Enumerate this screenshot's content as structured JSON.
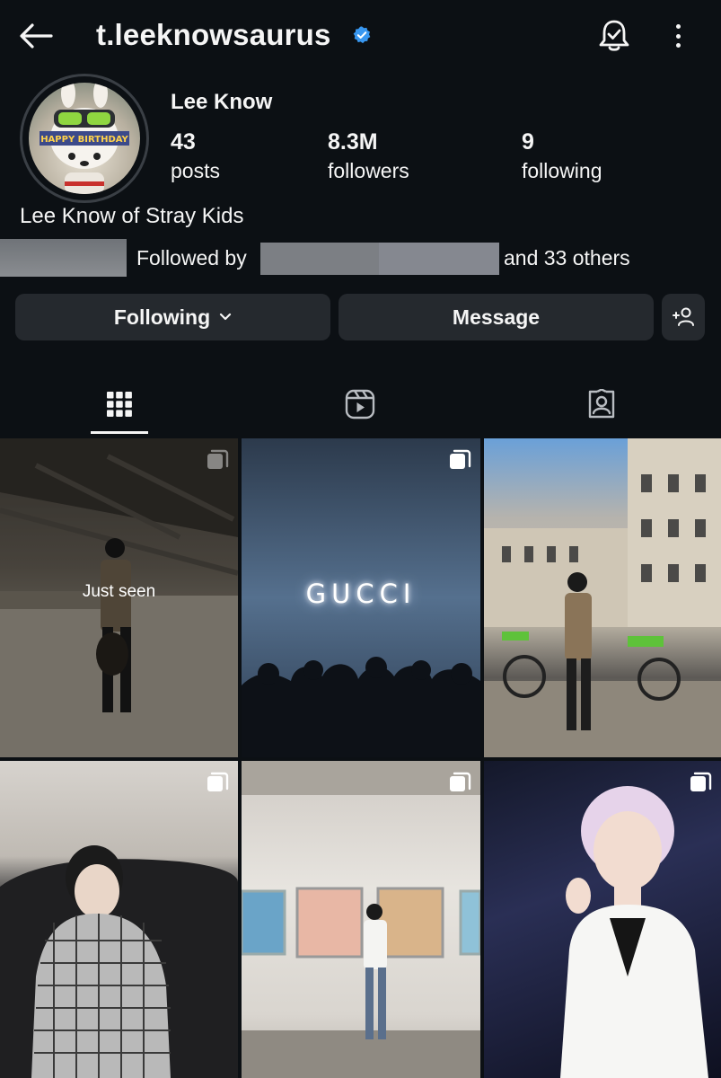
{
  "header": {
    "username": "t.leeknowsaurus",
    "verified": true,
    "icons": [
      "back-arrow-icon",
      "verified-badge-icon",
      "notification-bell-icon",
      "more-options-icon"
    ]
  },
  "profile": {
    "display_name": "Lee Know",
    "avatar_text": "HAPPY BIRTHDAY",
    "stats": {
      "posts_count": "43",
      "posts_label": "posts",
      "followers_count": "8.3M",
      "followers_label": "followers",
      "following_count": "9",
      "following_label": "following"
    },
    "bio": "Lee Know of Stray Kids",
    "followed_by_label": "Followed by",
    "followed_by_others": "and 33 others"
  },
  "actions": {
    "following_label": "Following",
    "message_label": "Message",
    "add_user_icon": "add-person-icon"
  },
  "tabs": [
    {
      "name": "posts-grid",
      "icon": "grid-icon",
      "active": true
    },
    {
      "name": "reels",
      "icon": "reels-icon",
      "active": false
    },
    {
      "name": "tagged",
      "icon": "tagged-person-icon",
      "active": false
    }
  ],
  "grid": {
    "posts": [
      {
        "overlay_text": "Just seen",
        "multi": true,
        "seen": true
      },
      {
        "sign_text": "GUCCI",
        "multi": true
      },
      {
        "multi": false
      },
      {
        "multi": true
      },
      {
        "multi": true
      },
      {
        "multi": true
      }
    ]
  },
  "colors": {
    "background": "#0c1014",
    "button_bg": "#25292e",
    "verified_blue": "#3897f0",
    "text": "#f5f5f5"
  }
}
